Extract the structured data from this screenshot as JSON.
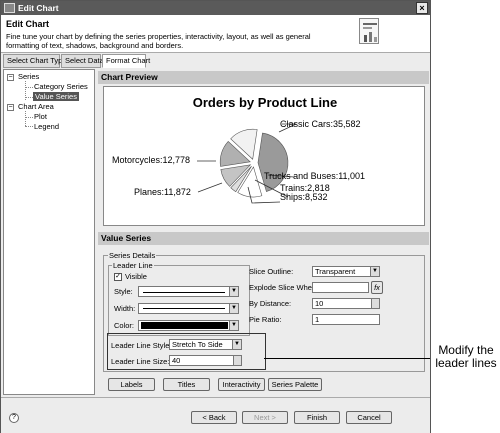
{
  "window": {
    "title": "Edit Chart",
    "close_glyph": "×"
  },
  "header": {
    "title": "Edit Chart",
    "description": "Fine tune your chart by defining the series properties, interactivity, layout, as well as general formatting of text, shadows, background and borders."
  },
  "tabs": [
    "Select Chart Type",
    "Select Data",
    "Format Chart"
  ],
  "tree": {
    "series": "Series",
    "category_series": "Category Series",
    "value_series": "Value Series",
    "chart_area": "Chart Area",
    "plot": "Plot",
    "legend": "Legend",
    "collapse_glyph": "−"
  },
  "preview": {
    "header": "Chart Preview",
    "chart_title": "Orders by Product Line",
    "labels": {
      "classic_cars": "Classic Cars:35,582",
      "motorcycles": "Motorcycles:12,778",
      "trucks": "Trucks and Buses:11,001",
      "planes": "Planes:11,872",
      "trains": "Trains:2,818",
      "ships": "Ships:8,532"
    }
  },
  "chart_data": {
    "type": "pie",
    "title": "Orders by Product Line",
    "categories": [
      "Classic Cars",
      "Motorcycles",
      "Planes",
      "Ships",
      "Trains",
      "Trucks and Buses"
    ],
    "values": [
      35582,
      12778,
      11872,
      8532,
      2818,
      11001
    ]
  },
  "value_series": {
    "header": "Value Series",
    "series_details": "Series Details",
    "leader_line": "Leader Line",
    "visible_label": "Visible",
    "visible_checked": true,
    "check_glyph": "✓",
    "style_label": "Style:",
    "width_label": "Width:",
    "color_label": "Color:",
    "leader_style_label": "Leader Line Style:",
    "leader_style_value": "Stretch To Side",
    "leader_size_label": "Leader Line Size:",
    "leader_size_value": "40",
    "slice_outline_label": "Slice Outline:",
    "slice_outline_value": "Transparent",
    "explode_label": "Explode Slice When:",
    "fx_glyph": "fx",
    "distance_label": "By Distance:",
    "distance_value": "10",
    "pie_ratio_label": "Pie Ratio:",
    "pie_ratio_value": "1",
    "dropdown_glyph": "▼"
  },
  "buttons": {
    "labels": "Labels",
    "titles": "Titles",
    "interactivity": "Interactivity",
    "series_palette": "Series Palette"
  },
  "footer": {
    "help_glyph": "?",
    "back": "< Back",
    "next": "Next >",
    "finish": "Finish",
    "cancel": "Cancel"
  },
  "callout": "Modify the leader lines"
}
